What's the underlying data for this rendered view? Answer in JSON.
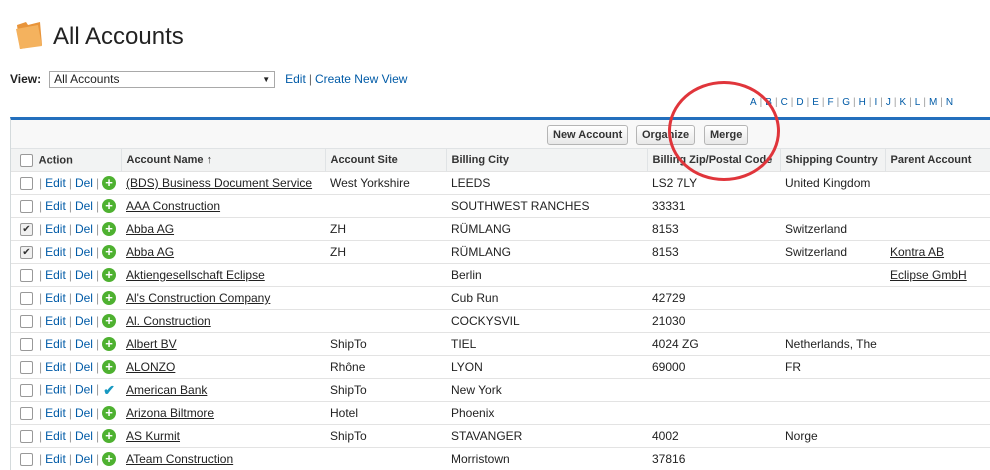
{
  "page": {
    "title": "All Accounts"
  },
  "view": {
    "label": "View:",
    "selected": "All Accounts",
    "edit_link": "Edit",
    "create_link": "Create New View",
    "separator": "|"
  },
  "alphabet": [
    "A",
    "B",
    "C",
    "D",
    "E",
    "F",
    "G",
    "H",
    "I",
    "J",
    "K",
    "L",
    "M",
    "N"
  ],
  "buttons": {
    "new_account": "New Account",
    "organize": "Organize",
    "merge": "Merge"
  },
  "columns": {
    "action": "Action",
    "account_name": "Account Name",
    "sort_indicator": "↑",
    "account_site": "Account Site",
    "billing_city": "Billing City",
    "billing_zip": "Billing Zip/Postal Code",
    "shipping_country": "Shipping Country",
    "parent_account": "Parent Account"
  },
  "row_actions": {
    "edit": "Edit",
    "del": "Del",
    "separator": "|"
  },
  "rows": [
    {
      "name": "(BDS) Business Document Service",
      "site": "West Yorkshire",
      "city": "LEEDS",
      "zip": "LS2 7LY",
      "country": "United Kingdom",
      "parent": "",
      "checked": false,
      "icon": "plus"
    },
    {
      "name": "AAA Construction",
      "site": "",
      "city": "SOUTHWEST RANCHES",
      "zip": "33331",
      "country": "",
      "parent": "",
      "checked": false,
      "icon": "plus"
    },
    {
      "name": "Abba AG",
      "site": "ZH",
      "city": "RÜMLANG",
      "zip": "8153",
      "country": "Switzerland",
      "parent": "",
      "checked": true,
      "icon": "plus"
    },
    {
      "name": "Abba AG",
      "site": "ZH",
      "city": "RÜMLANG",
      "zip": "8153",
      "country": "Switzerland",
      "parent": "Kontra AB",
      "checked": true,
      "icon": "plus"
    },
    {
      "name": "Aktiengesellschaft Eclipse",
      "site": "",
      "city": "Berlin",
      "zip": "",
      "country": "",
      "parent": "Eclipse GmbH",
      "checked": false,
      "icon": "plus"
    },
    {
      "name": "Al's Construction Company",
      "site": "",
      "city": "Cub Run",
      "zip": "42729",
      "country": "",
      "parent": "",
      "checked": false,
      "icon": "plus"
    },
    {
      "name": "Al. Construction",
      "site": "",
      "city": "COCKYSVIL",
      "zip": "21030",
      "country": "",
      "parent": "",
      "checked": false,
      "icon": "plus"
    },
    {
      "name": "Albert BV",
      "site": "ShipTo",
      "city": "TIEL",
      "zip": "4024 ZG",
      "country": "Netherlands, The",
      "parent": "",
      "checked": false,
      "icon": "plus"
    },
    {
      "name": "ALONZO",
      "site": "Rhône",
      "city": "LYON",
      "zip": "69000",
      "country": "FR",
      "parent": "",
      "checked": false,
      "icon": "plus"
    },
    {
      "name": "American Bank",
      "site": "ShipTo",
      "city": "New York",
      "zip": "",
      "country": "",
      "parent": "",
      "checked": false,
      "icon": "check"
    },
    {
      "name": "Arizona Biltmore",
      "site": "Hotel",
      "city": "Phoenix",
      "zip": "",
      "country": "",
      "parent": "",
      "checked": false,
      "icon": "plus"
    },
    {
      "name": "AS Kurmit",
      "site": "ShipTo",
      "city": "STAVANGER",
      "zip": "4002",
      "country": "Norge",
      "parent": "",
      "checked": false,
      "icon": "plus"
    },
    {
      "name": "ATeam Construction",
      "site": "",
      "city": "Morristown",
      "zip": "37816",
      "country": "",
      "parent": "",
      "checked": false,
      "icon": "plus"
    }
  ]
}
